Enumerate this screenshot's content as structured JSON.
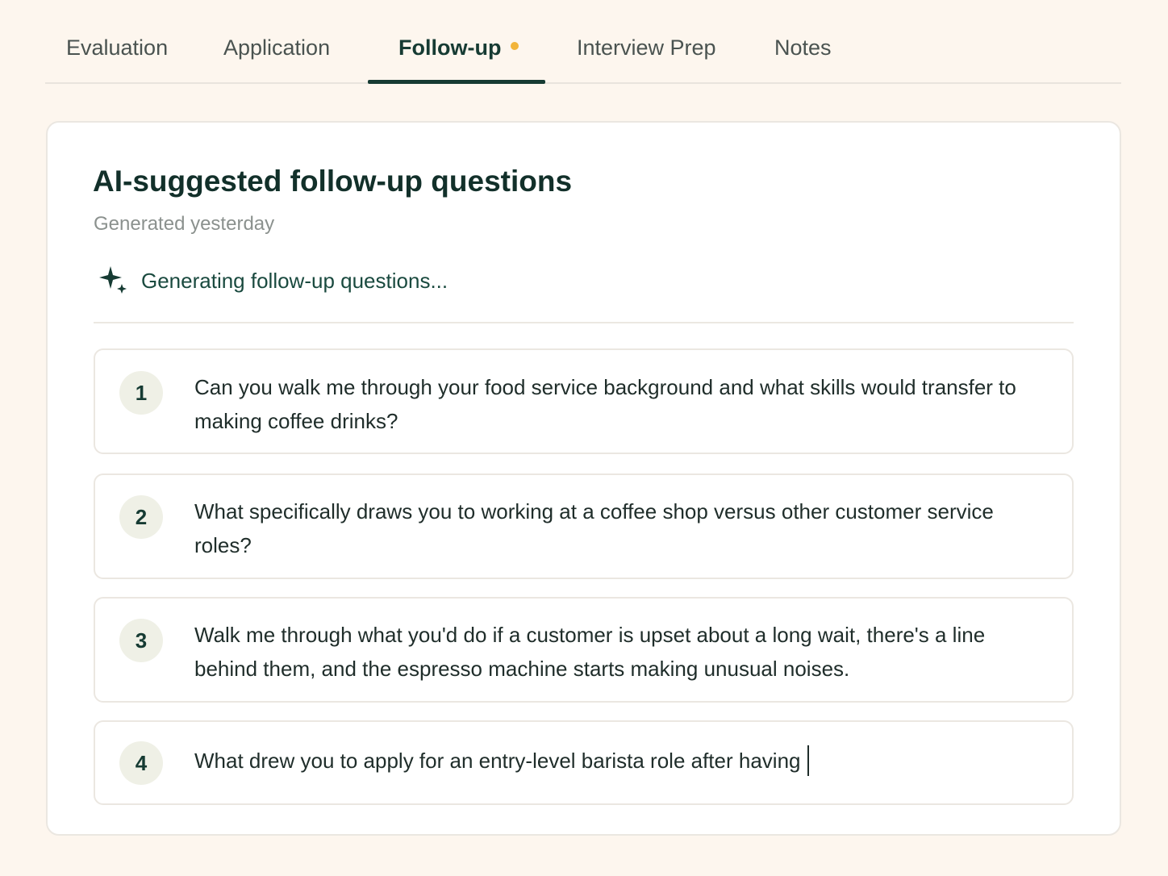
{
  "tabs": [
    {
      "label": "Evaluation"
    },
    {
      "label": "Application"
    },
    {
      "label": "Follow-up",
      "active": true,
      "has_indicator": true
    },
    {
      "label": "Interview Prep"
    },
    {
      "label": "Notes"
    }
  ],
  "card": {
    "title": "AI-suggested follow-up questions",
    "subtitle": "Generated yesterday",
    "status_icon": "sparkle-icon",
    "status_text": "Generating follow-up questions..."
  },
  "questions": [
    {
      "number": "1",
      "text": "Can you walk me through your food service background and what skills would transfer to making coffee drinks?"
    },
    {
      "number": "2",
      "text": "What specifically draws you to working at a coffee shop versus other customer service roles?"
    },
    {
      "number": "3",
      "text": "Walk me through what you'd do if a customer is upset about a long wait, there's a line behind them, and the espresso machine starts making unusual noises."
    },
    {
      "number": "4",
      "text": "What drew you to apply for an entry-level barista role after having"
    }
  ],
  "colors": {
    "background": "#fdf6ee",
    "accent": "#163b33",
    "indicator": "#f2b43a"
  }
}
